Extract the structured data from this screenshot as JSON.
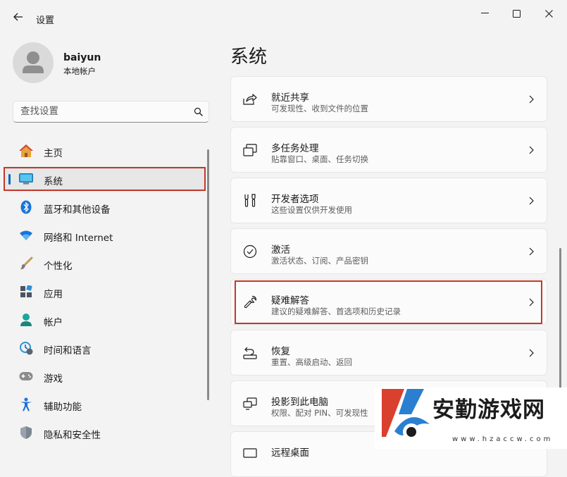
{
  "window": {
    "title": "设置",
    "back_icon": "arrow-left-icon",
    "controls": [
      "minimize-icon",
      "maximize-icon",
      "close-icon"
    ]
  },
  "user": {
    "name": "baiyun",
    "account_type": "本地帐户"
  },
  "search": {
    "placeholder": "查找设置",
    "value": ""
  },
  "sidebar": {
    "items": [
      {
        "label": "主页",
        "icon": "home-icon",
        "selected": false
      },
      {
        "label": "系统",
        "icon": "system-monitor-icon",
        "selected": true
      },
      {
        "label": "蓝牙和其他设备",
        "icon": "bluetooth-icon",
        "selected": false
      },
      {
        "label": "网络和 Internet",
        "icon": "wifi-icon",
        "selected": false
      },
      {
        "label": "个性化",
        "icon": "paintbrush-icon",
        "selected": false
      },
      {
        "label": "应用",
        "icon": "apps-icon",
        "selected": false
      },
      {
        "label": "帐户",
        "icon": "account-icon",
        "selected": false
      },
      {
        "label": "时间和语言",
        "icon": "time-language-icon",
        "selected": false
      },
      {
        "label": "游戏",
        "icon": "gamepad-icon",
        "selected": false
      },
      {
        "label": "辅助功能",
        "icon": "accessibility-icon",
        "selected": false
      },
      {
        "label": "隐私和安全性",
        "icon": "shield-icon",
        "selected": false
      }
    ]
  },
  "main": {
    "title": "系统",
    "cards": [
      {
        "title": "就近共享",
        "desc": "可发现性、收到文件的位置",
        "icon": "share-icon"
      },
      {
        "title": "多任务处理",
        "desc": "贴靠窗口、桌面、任务切换",
        "icon": "multitasking-icon"
      },
      {
        "title": "开发者选项",
        "desc": "这些设置仅供开发使用",
        "icon": "developer-tools-icon"
      },
      {
        "title": "激活",
        "desc": "激活状态、订阅、产品密钥",
        "icon": "activation-check-icon"
      },
      {
        "title": "疑难解答",
        "desc": "建议的疑难解答、首选项和历史记录",
        "icon": "wrench-icon"
      },
      {
        "title": "恢复",
        "desc": "重置、高级启动、返回",
        "icon": "recovery-icon"
      },
      {
        "title": "投影到此电脑",
        "desc": "权限、配对 PIN、可发现性",
        "icon": "projection-icon"
      },
      {
        "title": "远程桌面",
        "desc": "",
        "icon": "remote-desktop-icon"
      }
    ]
  },
  "colors": {
    "accent": "#0067c0",
    "highlight_box": "#c0392b",
    "background": "#f3f3f3",
    "card": "#fbfbfb"
  },
  "watermark": {
    "text": "安勤游戏网",
    "url": "www.hzaccw.com"
  }
}
